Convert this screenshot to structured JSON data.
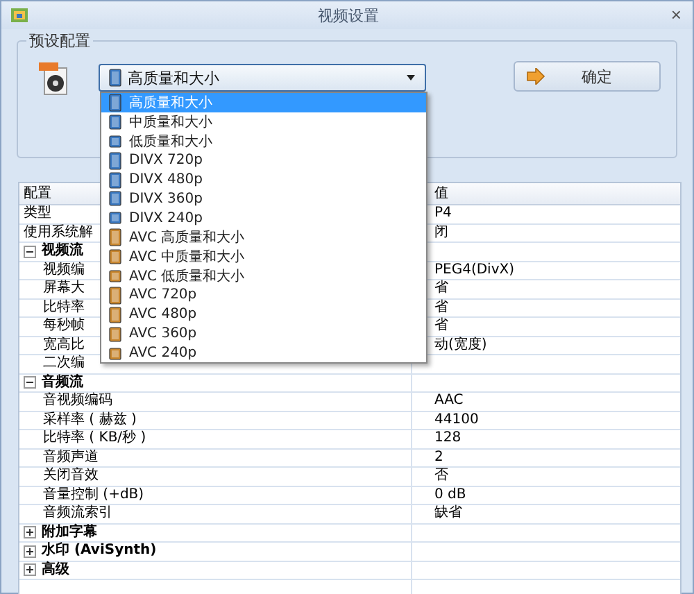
{
  "window": {
    "title": "视频设置",
    "close": "×"
  },
  "preset": {
    "legend": "预设配置",
    "combo_value": "高质量和大小",
    "combo_open": true,
    "button": "确定"
  },
  "dropdown": [
    {
      "label": "高质量和大小",
      "color": "#3a78c0",
      "selected": true
    },
    {
      "label": "中质量和大小",
      "color": "#3a78c0",
      "selected": false
    },
    {
      "label": "低质量和大小",
      "color": "#3a78c0",
      "selected": false
    },
    {
      "label": "DIVX 720p",
      "color": "#3a78c0",
      "selected": false
    },
    {
      "label": "DIVX 480p",
      "color": "#3a78c0",
      "selected": false
    },
    {
      "label": "DIVX 360p",
      "color": "#3a78c0",
      "selected": false
    },
    {
      "label": "DIVX 240p",
      "color": "#3a78c0",
      "selected": false
    },
    {
      "label": "AVC 高质量和大小",
      "color": "#c8862e",
      "selected": false
    },
    {
      "label": "AVC 中质量和大小",
      "color": "#c8862e",
      "selected": false
    },
    {
      "label": "AVC 低质量和大小",
      "color": "#c8862e",
      "selected": false
    },
    {
      "label": "AVC 720p",
      "color": "#c8862e",
      "selected": false
    },
    {
      "label": "AVC 480p",
      "color": "#c8862e",
      "selected": false
    },
    {
      "label": "AVC 360p",
      "color": "#c8862e",
      "selected": false
    },
    {
      "label": "AVC 240p",
      "color": "#c8862e",
      "selected": false
    }
  ],
  "table": {
    "columns": [
      "配置",
      "值"
    ],
    "rows": [
      {
        "kind": "item",
        "label": "类型",
        "value": "P4"
      },
      {
        "kind": "item",
        "label": "使用系统解",
        "value": "闭"
      },
      {
        "kind": "group",
        "label": "视频流",
        "expanded": true,
        "children": [
          {
            "kind": "item",
            "label": "视频编",
            "value": "PEG4(DivX)"
          },
          {
            "kind": "item",
            "label": "屏幕大",
            "value": "省"
          },
          {
            "kind": "item",
            "label": "比特率",
            "value": "省"
          },
          {
            "kind": "item",
            "label": "每秒帧",
            "value": "省"
          },
          {
            "kind": "item",
            "label": "宽高比",
            "value": "动(宽度)"
          },
          {
            "kind": "item",
            "label": "二次编"
          }
        ]
      },
      {
        "kind": "group",
        "label": "音频流",
        "expanded": true,
        "children": [
          {
            "kind": "item",
            "label": "音视频编码",
            "value": "AAC"
          },
          {
            "kind": "item",
            "label": "采样率 ( 赫兹 )",
            "value": "44100"
          },
          {
            "kind": "item",
            "label": "比特率 ( KB/秒 )",
            "value": "128"
          },
          {
            "kind": "item",
            "label": "音频声道",
            "value": "2"
          },
          {
            "kind": "item",
            "label": "关闭音效",
            "value": "否"
          },
          {
            "kind": "item",
            "label": "音量控制 (+dB)",
            "value": "0 dB"
          },
          {
            "kind": "item",
            "label": "音频流索引",
            "value": "缺省"
          }
        ]
      },
      {
        "kind": "group",
        "label": "附加字幕",
        "expanded": false
      },
      {
        "kind": "group",
        "label": "水印 (AviSynth)",
        "expanded": false
      },
      {
        "kind": "group",
        "label": "高级",
        "expanded": false
      },
      {
        "kind": "blank"
      }
    ]
  }
}
